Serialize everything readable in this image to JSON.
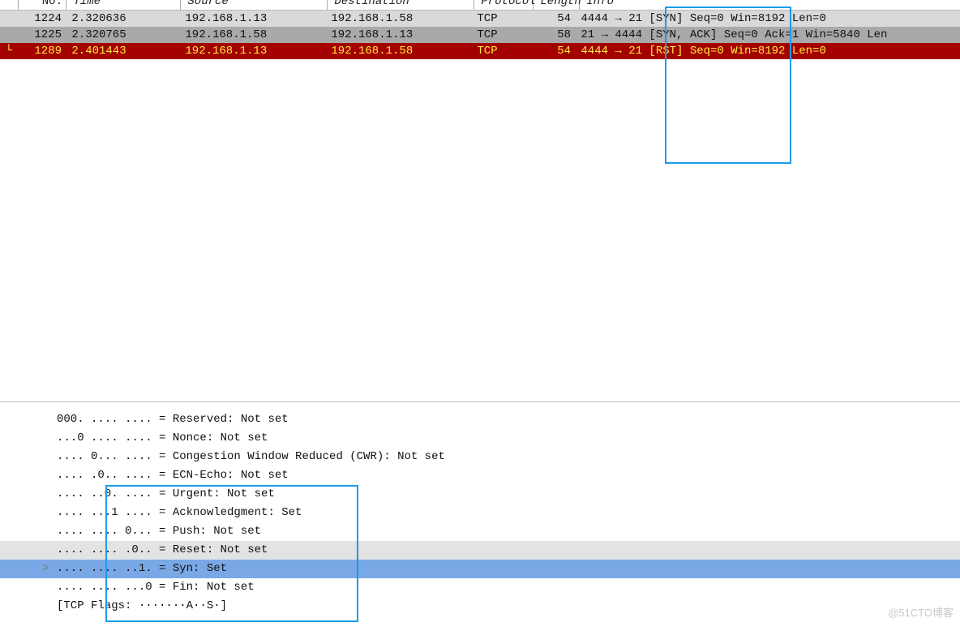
{
  "packet_list": {
    "columns": [
      "No.",
      "Time",
      "Source",
      "Destination",
      "Protocol",
      "Length",
      "Info"
    ],
    "rows": [
      {
        "mark": "",
        "no": "1224",
        "time": "2.320636",
        "src": "192.168.1.13",
        "dst": "192.168.1.58",
        "proto": "TCP",
        "len": "54",
        "info": "4444 → 21 [SYN] Seq=0 Win=8192 Len=0"
      },
      {
        "mark": "",
        "no": "1225",
        "time": "2.320765",
        "src": "192.168.1.58",
        "dst": "192.168.1.13",
        "proto": "TCP",
        "len": "58",
        "info": "21 → 4444 [SYN, ACK] Seq=0 Ack=1 Win=5840 Len"
      },
      {
        "mark": "└",
        "no": "1289",
        "time": "2.401443",
        "src": "192.168.1.13",
        "dst": "192.168.1.58",
        "proto": "TCP",
        "len": "54",
        "info": "4444 → 21 [RST] Seq=0 Win=8192 Len=0"
      }
    ]
  },
  "flags": {
    "lines": [
      {
        "txt": "000. .... .... = Reserved: Not set"
      },
      {
        "txt": "...0 .... .... = Nonce: Not set"
      },
      {
        "txt": ".... 0... .... = Congestion Window Reduced (CWR): Not set"
      },
      {
        "txt": ".... .0.. .... = ECN-Echo: Not set"
      },
      {
        "txt": ".... ..0. .... = Urgent: Not set"
      },
      {
        "txt": ".... ...1 .... = Acknowledgment: Set"
      },
      {
        "txt": ".... .... 0... = Push: Not set"
      },
      {
        "txt": ".... .... .0.. = Reset: Not set",
        "hl": "grey"
      },
      {
        "txt": ".... .... ..1. = Syn: Set",
        "hl": "blue",
        "arrow": true
      },
      {
        "txt": ".... .... ...0 = Fin: Not set"
      },
      {
        "txt": "[TCP Flags: ·······A··S·]"
      }
    ]
  },
  "watermark": "@51CTO博客"
}
